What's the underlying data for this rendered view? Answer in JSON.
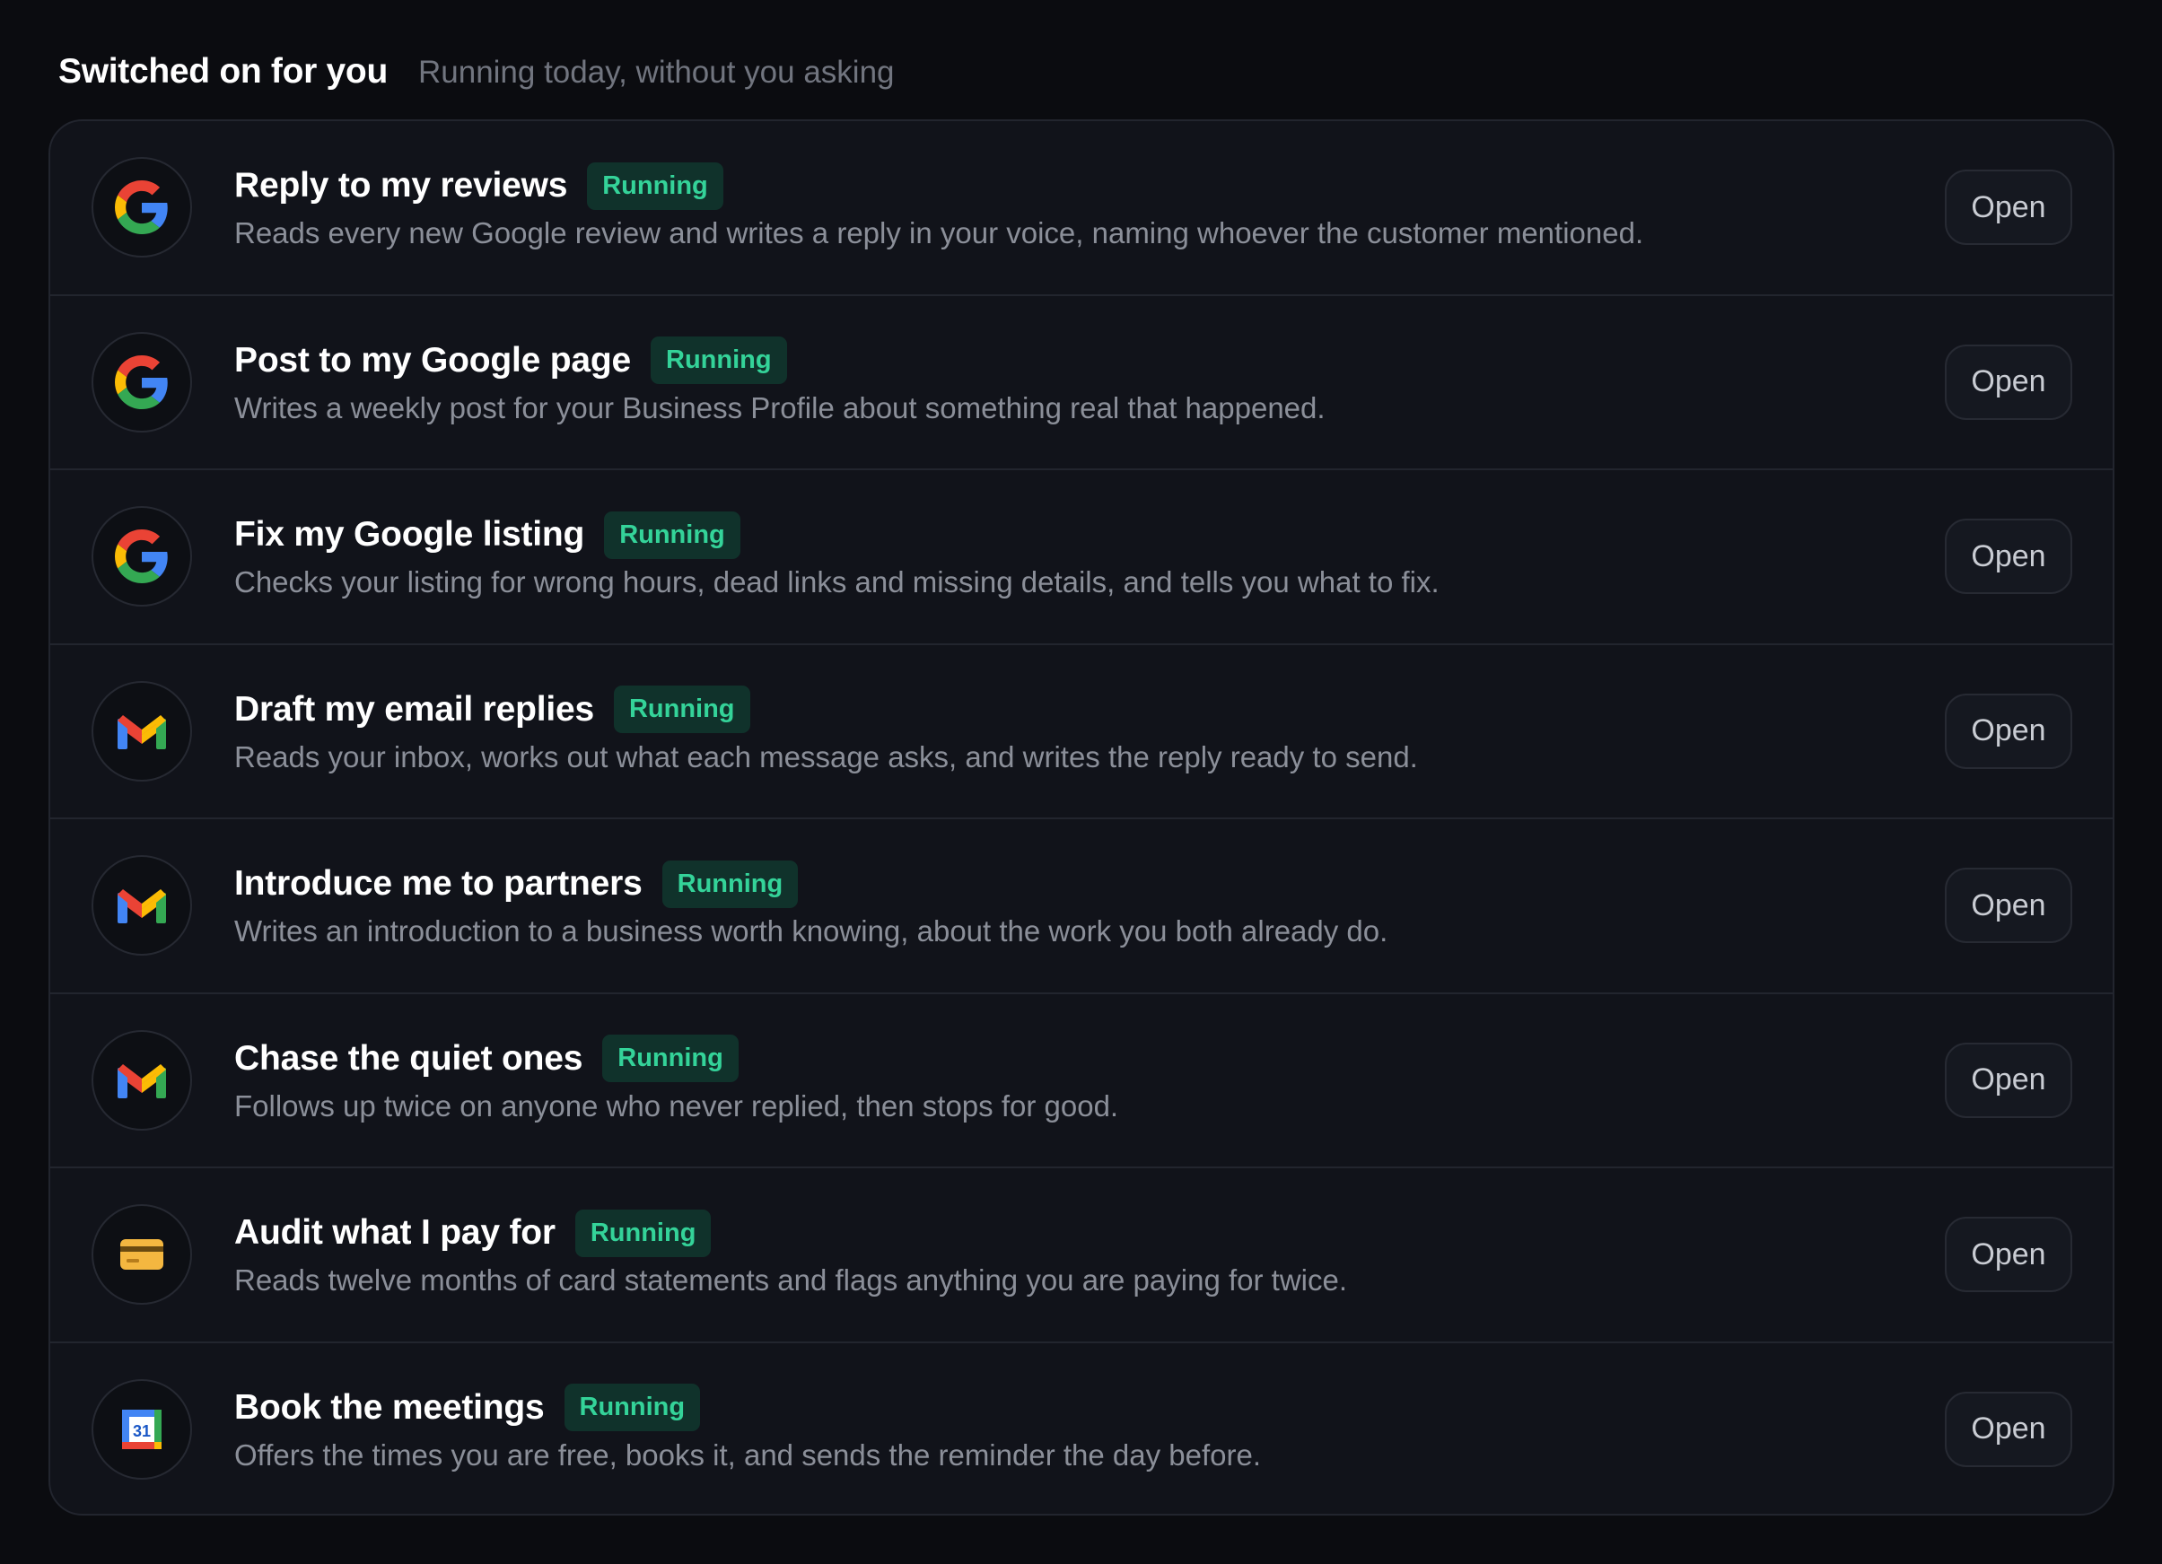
{
  "header": {
    "title": "Switched on for you",
    "subtitle": "Running today, without you asking"
  },
  "colors": {
    "accent_green": "#34d399",
    "badge_bg": "#10322b",
    "panel_bg": "#11131a",
    "page_bg": "#0b0c10"
  },
  "items": [
    {
      "icon": "google-icon",
      "title": "Reply to my reviews",
      "status": "Running",
      "description": "Reads every new Google review and writes a reply in your voice, naming whoever the customer mentioned.",
      "action": "Open"
    },
    {
      "icon": "google-icon",
      "title": "Post to my Google page",
      "status": "Running",
      "description": "Writes a weekly post for your Business Profile about something real that happened.",
      "action": "Open"
    },
    {
      "icon": "google-icon",
      "title": "Fix my Google listing",
      "status": "Running",
      "description": "Checks your listing for wrong hours, dead links and missing details, and tells you what to fix.",
      "action": "Open"
    },
    {
      "icon": "gmail-icon",
      "title": "Draft my email replies",
      "status": "Running",
      "description": "Reads your inbox, works out what each message asks, and writes the reply ready to send.",
      "action": "Open"
    },
    {
      "icon": "gmail-icon",
      "title": "Introduce me to partners",
      "status": "Running",
      "description": "Writes an introduction to a business worth knowing, about the work you both already do.",
      "action": "Open"
    },
    {
      "icon": "gmail-icon",
      "title": "Chase the quiet ones",
      "status": "Running",
      "description": "Follows up twice on anyone who never replied, then stops for good.",
      "action": "Open"
    },
    {
      "icon": "credit-card-icon",
      "title": "Audit what I pay for",
      "status": "Running",
      "description": "Reads twelve months of card statements and flags anything you are paying for twice.",
      "action": "Open"
    },
    {
      "icon": "calendar-icon",
      "title": "Book the meetings",
      "status": "Running",
      "description": "Offers the times you are free, books it, and sends the reminder the day before.",
      "action": "Open",
      "icon_text": "31"
    }
  ]
}
